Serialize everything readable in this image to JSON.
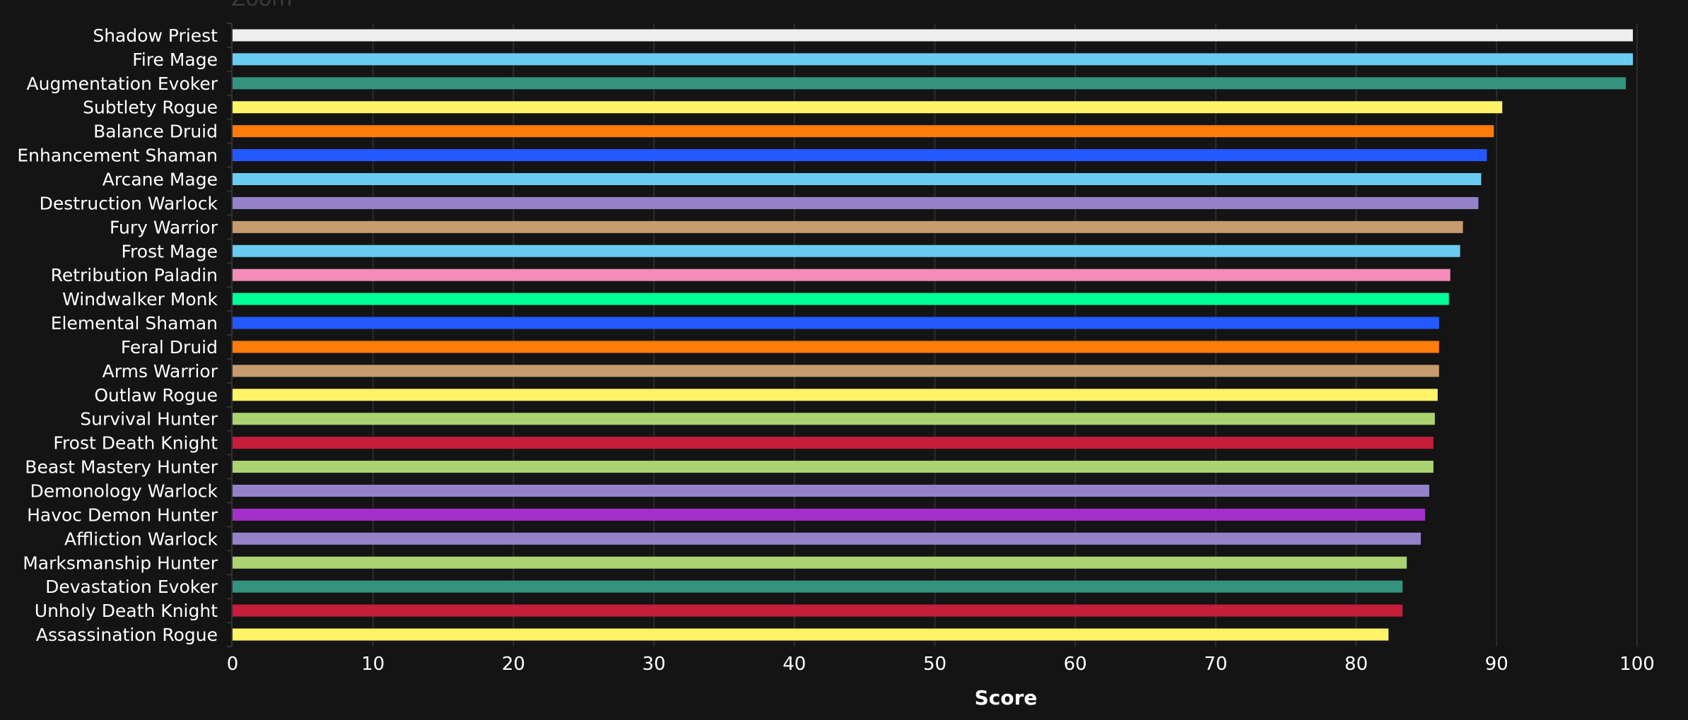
{
  "zoom_label": "Zoom",
  "chart_data": {
    "type": "bar",
    "orientation": "horizontal",
    "title": "",
    "xlabel": "Score",
    "ylabel": "",
    "xlim": [
      0,
      100
    ],
    "xticks": [
      0,
      10,
      20,
      30,
      40,
      50,
      60,
      70,
      80,
      90,
      100
    ],
    "grid": true,
    "legend": "none",
    "categories": [
      "Shadow Priest",
      "Fire Mage",
      "Augmentation Evoker",
      "Subtlety Rogue",
      "Balance Druid",
      "Enhancement Shaman",
      "Arcane Mage",
      "Destruction Warlock",
      "Fury Warrior",
      "Frost Mage",
      "Retribution Paladin",
      "Windwalker Monk",
      "Elemental Shaman",
      "Feral Druid",
      "Arms Warrior",
      "Outlaw Rogue",
      "Survival Hunter",
      "Frost Death Knight",
      "Beast Mastery Hunter",
      "Demonology Warlock",
      "Havoc Demon Hunter",
      "Affliction Warlock",
      "Marksmanship Hunter",
      "Devastation Evoker",
      "Unholy Death Knight",
      "Assassination Rogue"
    ],
    "values": [
      99.7,
      99.7,
      99.2,
      90.4,
      89.8,
      89.3,
      88.9,
      88.7,
      87.6,
      87.4,
      86.7,
      86.6,
      85.9,
      85.9,
      85.9,
      85.8,
      85.6,
      85.5,
      85.5,
      85.2,
      84.9,
      84.6,
      83.6,
      83.3,
      83.3,
      82.3
    ],
    "colors": [
      "#EEEEEE",
      "#69CCF0",
      "#33937F",
      "#FFF468",
      "#FF7C0A",
      "#2459FF",
      "#69CCF0",
      "#9482C9",
      "#C69B6D",
      "#69CCF0",
      "#F48CBA",
      "#00FF98",
      "#2459FF",
      "#FF7C0A",
      "#C69B6D",
      "#FFF468",
      "#AAD372",
      "#C41E3A",
      "#AAD372",
      "#9482C9",
      "#A330C9",
      "#9482C9",
      "#AAD372",
      "#33937F",
      "#C41E3A",
      "#FFF468"
    ]
  }
}
